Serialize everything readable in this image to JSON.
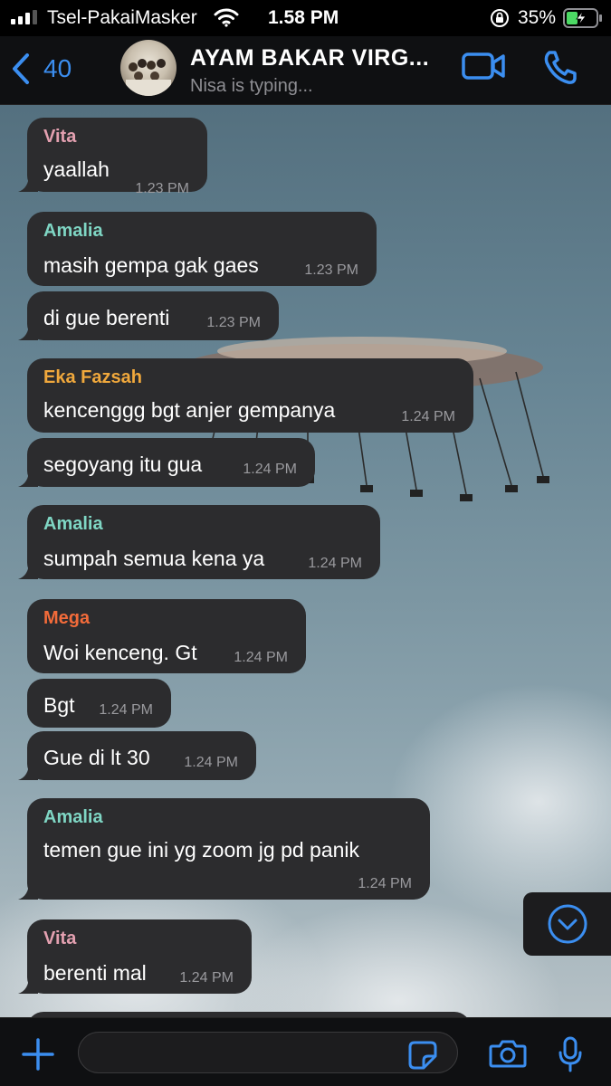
{
  "status_bar": {
    "carrier": "Tsel-PakaiMasker",
    "time": "1.58 PM",
    "battery_percent": "35%",
    "icons": [
      "signal-icon",
      "wifi-icon",
      "rotation-lock-icon",
      "battery-charging-icon"
    ]
  },
  "header": {
    "back_count": "40",
    "title": "AYAM BAKAR VIRG...",
    "subtitle": "Nisa is typing...",
    "icons": [
      "back-chevron-icon",
      "video-call-icon",
      "phone-icon"
    ]
  },
  "colors": {
    "accent": "#3b8ef0",
    "bubble": "#2c2c2e",
    "sender_vita": "#e3a0b0",
    "sender_amalia": "#7fd6c4",
    "sender_eka": "#f0a83c",
    "sender_mega": "#f26b3a"
  },
  "messages": [
    {
      "sender": "Vita",
      "text": "yaallah",
      "time": "1.23 PM"
    },
    {
      "sender": "Amalia",
      "text": "masih gempa gak gaes",
      "time": "1.23 PM"
    },
    {
      "sender": "",
      "text": "di gue berenti",
      "time": "1.23 PM"
    },
    {
      "sender": "Eka Fazsah",
      "text": "kencenggg bgt anjer gempanya",
      "time": "1.24 PM"
    },
    {
      "sender": "",
      "text": "segoyang itu gua",
      "time": "1.24 PM"
    },
    {
      "sender": "Amalia",
      "text": "sumpah semua kena ya",
      "time": "1.24 PM"
    },
    {
      "sender": "Mega",
      "text": "Woi kenceng. Gt",
      "time": "1.24 PM"
    },
    {
      "sender": "",
      "text": "Bgt",
      "time": "1.24 PM"
    },
    {
      "sender": "",
      "text": "Gue di lt 30",
      "time": "1.24 PM"
    },
    {
      "sender": "Amalia",
      "text": "temen gue ini yg zoom jg pd panik",
      "time": "1.24 PM"
    },
    {
      "sender": "Vita",
      "text": "berenti mal",
      "time": "1.24 PM"
    }
  ],
  "input_bar": {
    "placeholder": "",
    "icons": [
      "plus-icon",
      "sticker-icon",
      "camera-icon",
      "microphone-icon"
    ]
  }
}
